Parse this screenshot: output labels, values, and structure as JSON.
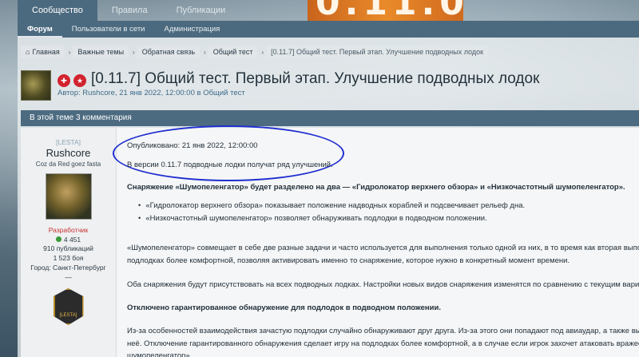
{
  "nav": {
    "tabs": [
      "Сообщество",
      "Правила",
      "Публикации"
    ],
    "subtabs": [
      "Форум",
      "Пользователи в сети",
      "Администрация"
    ]
  },
  "banner_text": "0.11.0",
  "breadcrumbs": [
    "Главная",
    "Важные темы",
    "Обратная связь",
    "Общий тест",
    "[0.11.7] Общий тест. Первый этап. Улучшение подводных лодок"
  ],
  "thread": {
    "title": "[0.11.7] Общий тест. Первый этап. Улучшение подводных лодок",
    "meta": "Автор: Rushcore, 21 янв 2022, 12:00:00 в Общий тест"
  },
  "comments_header": "В этой теме 3 комментария",
  "author": {
    "clan": "[LESTA]",
    "name": "Rushcore",
    "tagline": "Coz da Red goez fasta",
    "role": "Разработчик",
    "reputation": "4 451",
    "posts": "910 публикаций",
    "battles": "1 523 боя",
    "city": "Город: Санкт-Петербург",
    "dash": "—",
    "emblem_text": "[LESTA]"
  },
  "post": {
    "published": "Опубликовано: 21 янв 2022, 12:00:00",
    "intro": "В версии 0.11.7 подводные лодки получат ряд улучшений.",
    "equipment_line": "Снаряжение «Шумопеленгатор» будет разделено на два — «Гидролокатор верхнего обзора» и «Низкочастотный шумопеленгатор».",
    "bullets": [
      "«Гидролокатор верхнего обзора» показывает положение надводных кораблей и подсвечивает рельеф дна.",
      "«Низкочастотный шумопеленгатор» позволяет обнаруживать подлодки в подводном положении."
    ],
    "para1_line1": "«Шумопеленгатор» совмещает в себе две разные задачи и часто используется для выполнения только одной из них, в то время как вторая выполня",
    "para1_line2": "подлодках более комфортной, позволяя активировать именно то снаряжение, которое нужно в конкретный момент времени.",
    "para2": "Оба снаряжения будут присутствовать на всех подводных лодках. Настройки новых видов снаряжения изменятся по сравнению с текущим вариан",
    "heading2": "Отключено гарантированное обнаружение для подлодок в подводном положении.",
    "para3_line1": "Из-за особенностей взаимодействия зачастую подлодки случайно обнаруживают друг друга. Из-за этого они попадают под авиаудар, а также вынуж",
    "para3_line2": "неё. Отключение гарантированного обнаружения сделает игру на подлодках более комфортной, а в случае если игрок захочет атаковать вражеску",
    "para3_line3": "шумопеленгатор»."
  }
}
